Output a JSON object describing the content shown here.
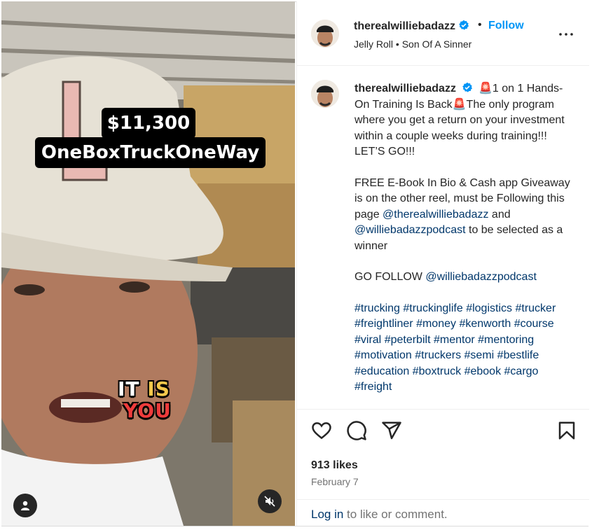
{
  "media": {
    "overlay_price": "$11,300",
    "overlay_route": "OneBoxTruckOneWay",
    "caption_word1": "IT",
    "caption_word2": "IS",
    "caption_word3": "YOU"
  },
  "post": {
    "username": "therealwilliebadazz",
    "follow_label": "Follow",
    "separator": "•",
    "audio": "Jelly Roll • Son Of A Sinner"
  },
  "caption": {
    "username": "therealwilliebadazz",
    "line1": "🚨1 on 1 Hands-On Training Is Back🚨The only program where you get a return on your investment within a couple weeks during training!!! LET’S GO!!!",
    "para2_text": "FREE E-Book In Bio & Cash app Giveaway is on the other reel, must be Following this page",
    "mention1": "@therealwilliebadazz",
    "and_text": " and ",
    "mention2": "@williebadazzpodcast",
    "para2_end": " to be selected as a winner",
    "go_follow": "GO FOLLOW ",
    "mention3": "@williebadazzpodcast",
    "hashtags": [
      "#trucking",
      "#truckinglife",
      "#logistics",
      "#trucker",
      "#freightliner",
      "#money",
      "#kenworth",
      "#course",
      "#viral",
      "#peterbilt",
      "#mentor",
      "#mentoring",
      "#motivation",
      "#truckers",
      "#semi",
      "#bestlife",
      "#education",
      "#boxtruck",
      "#ebook",
      "#cargo",
      "#freight"
    ]
  },
  "stats": {
    "likes": "913 likes",
    "date": "February 7"
  },
  "footer": {
    "login_link": "Log in",
    "login_rest": " to like or comment."
  },
  "colors": {
    "accent": "#0095f6",
    "link": "#00376b",
    "verified": "#0095f6"
  }
}
